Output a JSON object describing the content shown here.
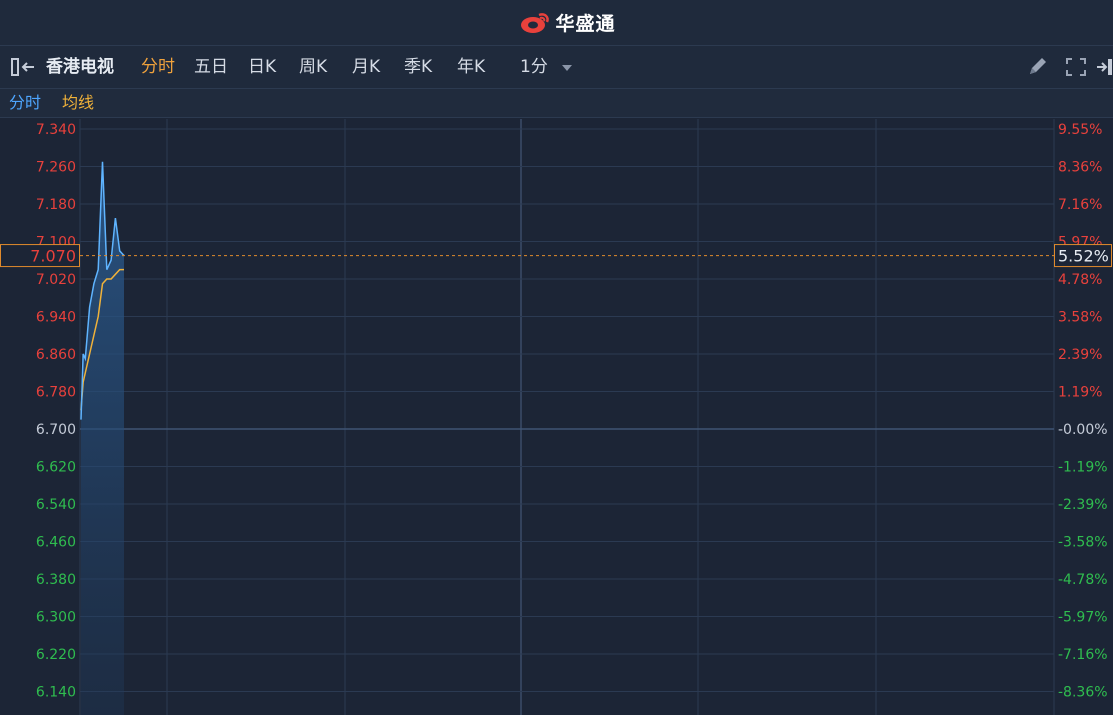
{
  "app": {
    "brand_name": "华盛通"
  },
  "toolbar": {
    "stock_name": "香港电视",
    "tabs": [
      {
        "label": "分时",
        "active": true
      },
      {
        "label": "五日",
        "active": false
      },
      {
        "label": "日K",
        "active": false
      },
      {
        "label": "周K",
        "active": false
      },
      {
        "label": "月K",
        "active": false
      },
      {
        "label": "季K",
        "active": false
      },
      {
        "label": "年K",
        "active": false
      }
    ],
    "interval_label": "1分",
    "icons": [
      "sidebar-toggle-icon",
      "pencil-icon",
      "fullscreen-icon",
      "exit-icon"
    ]
  },
  "legend": {
    "items": [
      {
        "label": "分时",
        "color": "#4ea6ff"
      },
      {
        "label": "均线",
        "color": "#f0b23a"
      }
    ]
  },
  "colors": {
    "up": "#e8413c",
    "down": "#2fbd4f",
    "neutral": "#c5ccd8",
    "price_line": "#5fb4ff",
    "avg_line": "#f0b23a",
    "current": "#e08a2c",
    "background": "#1c2536",
    "grid": "#2b3a52"
  },
  "chart_data": {
    "type": "line",
    "prev_close": 6.7,
    "current_price": "7.070",
    "current_change": "5.52%",
    "y_ticks_left": [
      "7.340",
      "7.260",
      "7.180",
      "7.100",
      "7.020",
      "6.940",
      "6.860",
      "6.780",
      "6.700",
      "6.620",
      "6.540",
      "6.460",
      "6.380",
      "6.300",
      "6.220",
      "6.140"
    ],
    "y_ticks_right": [
      "9.55%",
      "8.36%",
      "7.16%",
      "5.97%",
      "4.78%",
      "3.58%",
      "2.39%",
      "1.19%",
      "-0.00%",
      "-1.19%",
      "-2.39%",
      "-3.58%",
      "-4.78%",
      "-5.97%",
      "-7.16%",
      "-8.36%"
    ],
    "ylim": [
      6.14,
      7.34
    ],
    "series": [
      {
        "name": "分时",
        "x": [
          0,
          0.5,
          1,
          2,
          3,
          4,
          5,
          6,
          7,
          8,
          9,
          10
        ],
        "values": [
          6.72,
          6.86,
          6.85,
          6.96,
          7.01,
          7.04,
          7.27,
          7.04,
          7.06,
          7.15,
          7.08,
          7.07
        ]
      },
      {
        "name": "均线",
        "x": [
          0,
          0.5,
          1,
          2,
          3,
          4,
          5,
          6,
          7,
          8,
          9,
          10
        ],
        "values": [
          6.74,
          6.8,
          6.82,
          6.86,
          6.9,
          6.94,
          7.01,
          7.02,
          7.02,
          7.03,
          7.04,
          7.04
        ]
      }
    ],
    "grid": true
  }
}
